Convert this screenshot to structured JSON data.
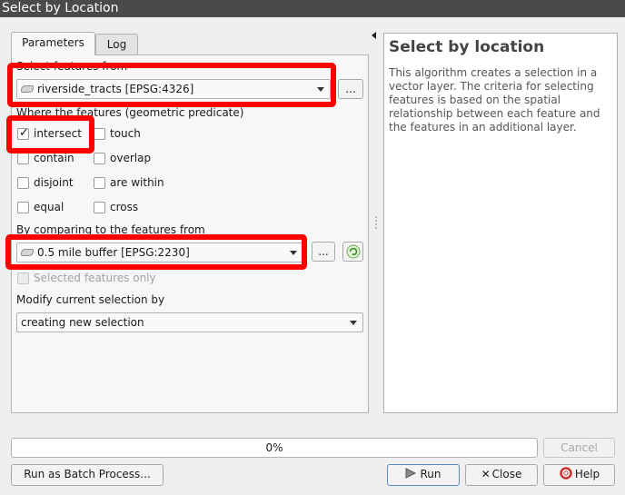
{
  "window": {
    "title": "Select by Location"
  },
  "tabs": [
    {
      "label": "Parameters",
      "active": true
    },
    {
      "label": "Log",
      "active": false
    }
  ],
  "params": {
    "input_label": "Select features from",
    "input_value": "riverside_tracts [EPSG:4326]",
    "browse_label": "...",
    "predicate_label": "Where the features (geometric predicate)",
    "predicates": [
      {
        "label": "intersect",
        "checked": true
      },
      {
        "label": "touch",
        "checked": false
      },
      {
        "label": "contain",
        "checked": false
      },
      {
        "label": "overlap",
        "checked": false
      },
      {
        "label": "disjoint",
        "checked": false
      },
      {
        "label": "are within",
        "checked": false
      },
      {
        "label": "equal",
        "checked": false
      },
      {
        "label": "cross",
        "checked": false
      }
    ],
    "compare_label": "By comparing to the features from",
    "compare_value": "0.5 mile buffer [EPSG:2230]",
    "compare_browse_label": "...",
    "selected_only_label": "Selected features only",
    "modify_label": "Modify current selection by",
    "modify_value": "creating new selection"
  },
  "help": {
    "title": "Select by location",
    "body": "This algorithm creates a selection in a vector layer. The criteria for selecting features is based on the spatial relationship between each feature and the features in an additional layer."
  },
  "progress": {
    "text": "0%",
    "value": 0
  },
  "buttons": {
    "cancel": "Cancel",
    "batch": "Run as Batch Process...",
    "run": "Run",
    "close": "Close",
    "help": "Help"
  },
  "colors": {
    "highlight": "#ff0000",
    "titlebar": "#4a4a4a"
  }
}
